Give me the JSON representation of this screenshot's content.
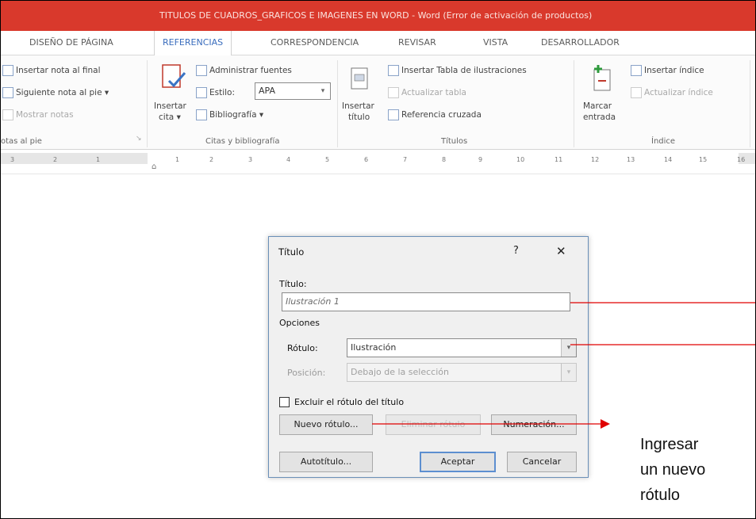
{
  "window": {
    "title": "TITULOS DE CUADROS_GRAFICOS E IMAGENES EN WORD -  Word (Error de activación de productos)"
  },
  "tabs": [
    "DISEÑO DE PÁGINA",
    "REFERENCIAS",
    "CORRESPONDENCIA",
    "REVISAR",
    "VISTA",
    "DESARROLLADOR"
  ],
  "active_tab": "REFERENCIAS",
  "ribbon": {
    "notas": {
      "insertar_nota_final": "Insertar nota al final",
      "siguiente_nota": "Siguiente nota al pie",
      "mostrar_notas": "Mostrar notas",
      "group_label": "otas al pie"
    },
    "citas": {
      "insertar_cita_1": "Insertar",
      "insertar_cita_2": "cita",
      "administrar_fuentes": "Administrar fuentes",
      "estilo_label": "Estilo:",
      "estilo_value": "APA",
      "bibliografia": "Bibliografía",
      "group_label": "Citas y bibliografía"
    },
    "titulos": {
      "insertar_titulo_1": "Insertar",
      "insertar_titulo_2": "título",
      "insertar_tabla_ilustraciones": "Insertar Tabla de ilustraciones",
      "actualizar_tabla": "Actualizar tabla",
      "referencia_cruzada": "Referencia cruzada",
      "group_label": "Títulos"
    },
    "indice": {
      "marcar_entrada_1": "Marcar",
      "marcar_entrada_2": "entrada",
      "insertar_indice": "Insertar índice",
      "actualizar_indice": "Actualizar índice",
      "group_label": "Índice"
    }
  },
  "ruler": {
    "ticks": [
      "3",
      "2",
      "1",
      "1",
      "2",
      "3",
      "4",
      "5",
      "6",
      "7",
      "8",
      "9",
      "10",
      "11",
      "12",
      "13",
      "14",
      "15",
      "16"
    ]
  },
  "dialog": {
    "title": "Título",
    "help": "?",
    "close": "✕",
    "titulo_label": "Título:",
    "titulo_value": "Ilustración 1",
    "opciones_label": "Opciones",
    "rotulo_label": "Rótulo:",
    "rotulo_value": "Ilustración",
    "posicion_label": "Posición:",
    "posicion_value": "Debajo de la selección",
    "excluir_label": "Excluir el rótulo del título",
    "nuevo_rotulo": "Nuevo rótulo...",
    "eliminar_rotulo": "Eliminar rótulo",
    "numeracion": "Numeración...",
    "autotitulo": "Autotítulo...",
    "aceptar": "Aceptar",
    "cancelar": "Cancelar"
  },
  "annotation": {
    "line1": "Ingresar",
    "line2": "un nuevo",
    "line3": "rótulo"
  },
  "colors": {
    "titlebar": "#d9392c",
    "accent": "#3a6dbd",
    "arrow": "#e00000"
  }
}
